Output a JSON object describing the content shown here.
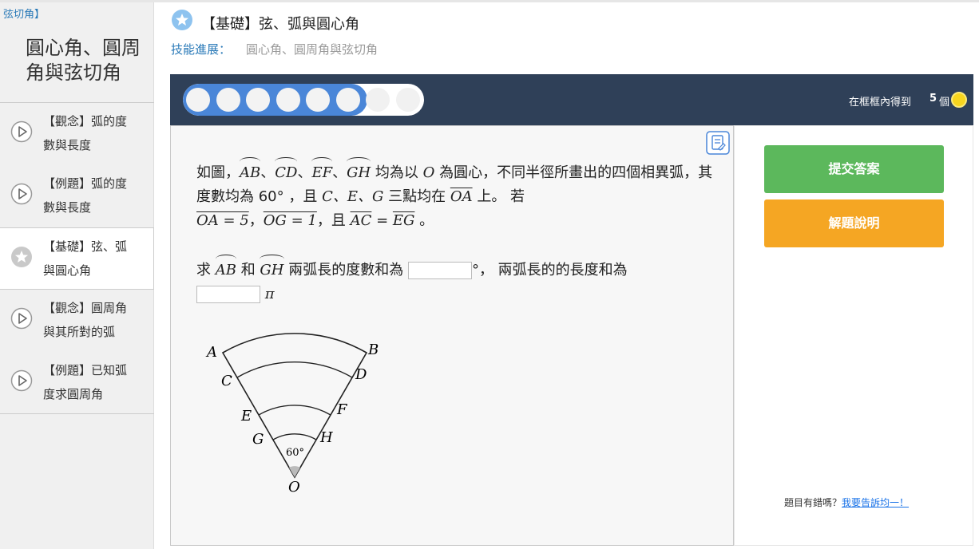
{
  "sidebar": {
    "breadcrumb": "弦切角】",
    "title": "圓心角、圓周角與弦切角",
    "items": [
      {
        "line1": "【觀念】弧的度",
        "line2": "數與長度",
        "icon": "play-icon",
        "active": false
      },
      {
        "line1": "【例題】弧的度",
        "line2": "數與長度",
        "icon": "play-icon",
        "active": false
      },
      {
        "line1": "【基礎】弦、弧",
        "line2": "與圓心角",
        "icon": "star-icon",
        "active": true
      },
      {
        "line1": "【觀念】圓周角",
        "line2": "與其所對的弧",
        "icon": "play-icon",
        "active": false
      },
      {
        "line1": "【例題】已知弧",
        "line2": "度求圓周角",
        "icon": "play-icon",
        "active": false
      }
    ]
  },
  "header": {
    "title": "【基礎】弦、弧與圓心角",
    "progress_label": "技能進展：",
    "progress_value": "圓心角、圓周角與弦切角"
  },
  "goal": {
    "text": "在框框內得到",
    "count": "5",
    "unit": "個",
    "filled": 6,
    "total": 8
  },
  "question": {
    "p1": "如圖，",
    "sep": "、",
    "p2": " 均為以 ",
    "O": "O",
    "p3": " 為圓心，不同半徑所畫出的四個相異弧，其度數均為 60° ，且 ",
    "points": "C、E、G",
    "p4": " 三點均在 ",
    "OA": "OA",
    "p5": " 上。 若",
    "cond1": "OA = 5",
    "comma": "，",
    "cond2": "OG = 1",
    "and": "，且 ",
    "AC": "AC",
    "eq": " = ",
    "EG": "EG",
    "end": " 。",
    "AB": "AB",
    "CD": "CD",
    "EF": "EF",
    "GH": "GH",
    "ask1": "求 ",
    "ask2": " 和 ",
    "ask3": " 兩弧長的度數和為 ",
    "ask4": "°， 兩弧長的的長度和為",
    "pi": "π"
  },
  "diagram": {
    "labels": {
      "A": "A",
      "B": "B",
      "C": "C",
      "D": "D",
      "E": "E",
      "F": "F",
      "G": "G",
      "H": "H",
      "O": "O"
    },
    "angle": "60°"
  },
  "actions": {
    "submit": "提交答案",
    "hint": "解題說明",
    "report_text": "題目有錯嗎？",
    "report_link": "我要告訴均一！"
  },
  "colors": {
    "dark_bar": "#2f4058",
    "progress_fill": "#4a86d8",
    "submit": "#5cb85c",
    "hint": "#f5a623",
    "link": "#2a7ab8"
  }
}
